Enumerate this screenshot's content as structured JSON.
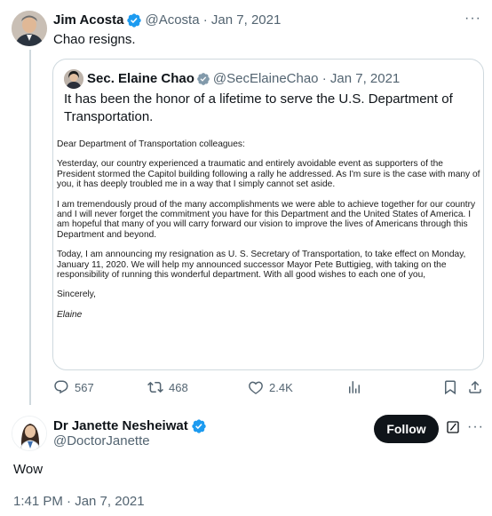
{
  "tweet": {
    "author_name": "Jim Acosta",
    "handle": "@Acosta",
    "date": "Jan 7, 2021",
    "text": "Chao resigns.",
    "more": "···"
  },
  "quote": {
    "author_name": "Sec. Elaine Chao",
    "handle": "@SecElaineChao",
    "date": "Jan 7, 2021",
    "text": "It has been the honor of a lifetime to serve the U.S. Department of Transportation.",
    "letter": {
      "salutation": "Dear Department of Transportation colleagues:",
      "p1": "Yesterday, our country experienced a traumatic and entirely avoidable event as supporters of the President stormed the Capitol building following a rally he addressed.  As I'm sure is the case with many of you, it has deeply troubled me in a way that I simply cannot set aside.",
      "p2": "I am tremendously proud of the many accomplishments we were able to achieve together for our country and I will never forget the commitment you have for this Department and the United States of America.  I am hopeful that many of you will carry forward our vision to improve the lives of Americans through this Department and beyond.",
      "p3": "Today, I am announcing my resignation as U. S. Secretary of Transportation, to take effect on Monday, January 11, 2020.  We will help my announced successor Mayor Pete Buttigieg, with taking on the responsibility of running this wonderful department.  With all good wishes to each one of you,",
      "closing": "Sincerely,",
      "signature": "Elaine"
    }
  },
  "actions": {
    "replies": "567",
    "retweets": "468",
    "likes": "2.4K"
  },
  "reply": {
    "author_name": "Dr Janette Nesheiwat",
    "handle": "@DoctorJanette",
    "follow_label": "Follow",
    "text": "Wow",
    "timestamp": "1:41 PM · Jan 7, 2021",
    "more": "···"
  },
  "colors": {
    "verified": "#1d9bf0",
    "muted": "#536471",
    "border": "#cfd9de"
  }
}
